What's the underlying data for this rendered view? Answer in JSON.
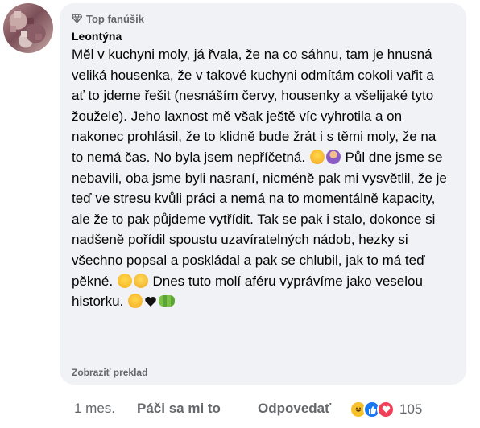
{
  "comment": {
    "badge": "Top fanúšik",
    "author": "Leontýna",
    "text_part1": "Měl v kuchyni moly, já řvala, že na co sáhnu, tam je hnusná veliká housenka, že v takové kuchyni odmítám cokoli vařit a ať to jdeme řešit (nesnáším červy, housenky a všelijaké tyto žoužele). Jeho laxnost mě však ještě víc vyhrotila a on nakonec prohlásil, že to klidně bude žrát i s těmi moly, že na to nemá čas. No byla jsem nepříčetná. ",
    "text_part2": " Půl dne jsme se nebavili, oba jsme byli nasraní, nicméně pak mi vysvětlil, že je teď ve stresu kvůli práci a nemá na to momentálně kapacity, ale že to pak půjdeme vytřídit. Tak se pak i stalo, dokonce si nadšeně pořídil spoustu uzavíratelných nádob, hezky si všechno popsal a poskládal a pak se chlubil, jak to má teď pěkné. ",
    "text_part3": " Dnes tuto molí aféru vyprávíme jako veselou historku. ",
    "emojis": {
      "after_part1": [
        "rolling-on-floor-laughing",
        "person-facepalming"
      ],
      "after_part2": [
        "grinning-face",
        "pensive-face"
      ],
      "after_part3": [
        "smiling-face",
        "black-heart",
        "bug"
      ]
    },
    "translate_label": "Zobraziť preklad"
  },
  "actions": {
    "time": "1 mes.",
    "like_label": "Páči sa mi to",
    "reply_label": "Odpovedať",
    "reaction_count": "105",
    "reaction_icons": [
      "haha",
      "like",
      "love"
    ]
  },
  "colors": {
    "bubble_bg": "#f0f2f5",
    "secondary_text": "#65676b",
    "like_blue": "#1877f2",
    "love_red": "#f33e58"
  }
}
